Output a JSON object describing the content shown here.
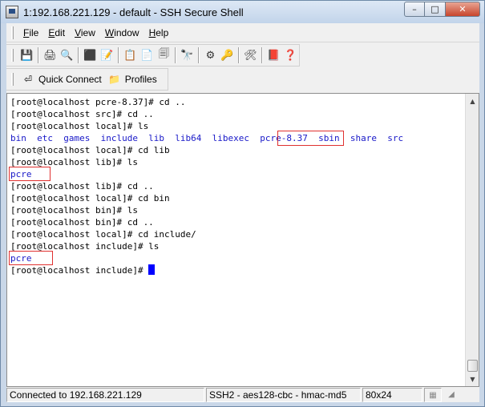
{
  "window": {
    "title": "1:192.168.221.129 - default - SSH Secure Shell",
    "min_glyph": "–",
    "max_glyph": "□",
    "close_glyph": "✕"
  },
  "menu": [
    {
      "accel": "F",
      "rest": "ile"
    },
    {
      "accel": "E",
      "rest": "dit"
    },
    {
      "accel": "V",
      "rest": "iew"
    },
    {
      "accel": "W",
      "rest": "indow"
    },
    {
      "accel": "H",
      "rest": "elp"
    }
  ],
  "toolbar_icons": {
    "save": "💾",
    "print": "🖨",
    "print_preview": "🔍",
    "disconnect": "⬛",
    "profile_edit": "📝",
    "copy": "📋",
    "paste": "📄",
    "paste_sel": "🗐",
    "find": "🔭",
    "settings": "⚙",
    "keys": "🔑",
    "tools": "🛠",
    "help_book": "📕",
    "context_help": "❓"
  },
  "toolbar2": {
    "quick_connect_label": "Quick Connect",
    "quick_connect_icon": "⏎",
    "profiles_label": "Profiles",
    "profiles_icon": "📁"
  },
  "terminal": {
    "lines": [
      "[root@localhost pcre-8.37]# cd ..",
      "[root@localhost src]# cd ..",
      "[root@localhost local]# ls",
      "bin  etc  games  include  lib  lib64  libexec  pcre-8.37  sbin  share  src",
      "[root@localhost local]# cd lib",
      "[root@localhost lib]# ls",
      "pcre",
      "[root@localhost lib]# cd ..",
      "[root@localhost local]# cd bin",
      "[root@localhost bin]# ls",
      "[root@localhost bin]# cd ..",
      "[root@localhost local]# cd include/",
      "[root@localhost include]# ls",
      "pcre",
      "[root@localhost include]# "
    ],
    "blue_lines": [
      3,
      6,
      13
    ]
  },
  "status": {
    "connection": "Connected to 192.168.221.129",
    "cipher": "SSH2 - aes128-cbc - hmac-md5",
    "size": "80x24"
  }
}
